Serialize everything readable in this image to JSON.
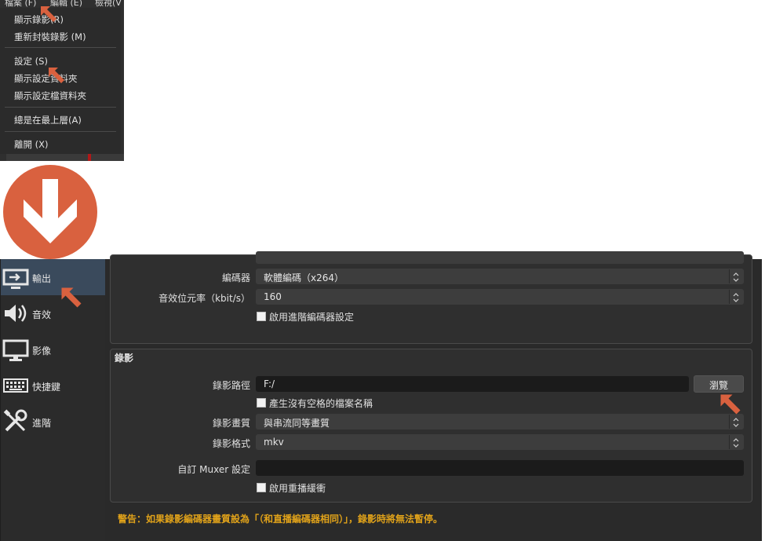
{
  "menubar": {
    "items": [
      "檔案 (F)",
      "編輯 (E)",
      "檢視(V"
    ]
  },
  "file_menu": {
    "items": [
      {
        "label": "顯示錄影(R)"
      },
      {
        "label": "重新封裝錄影 (M)"
      },
      {
        "label": "設定 (S)"
      },
      {
        "label": "顯示設定資料夾"
      },
      {
        "label": "顯示設定檔資料夾"
      },
      {
        "label": "總是在最上層(A)"
      },
      {
        "label": "離開 (X)"
      }
    ]
  },
  "colors": {
    "arrow": "#d9613f",
    "warning": "#e0a21a",
    "active_sidebar": "#3a4a5c"
  },
  "sidebar": {
    "items": [
      {
        "label": "輸出",
        "icon": "monitor-output-icon",
        "active": true
      },
      {
        "label": "音效",
        "icon": "speaker-icon"
      },
      {
        "label": "影像",
        "icon": "display-icon"
      },
      {
        "label": "快捷鍵",
        "icon": "keyboard-icon"
      },
      {
        "label": "進階",
        "icon": "tools-icon"
      }
    ]
  },
  "streaming": {
    "encoder_label": "編碼器",
    "encoder_value": "軟體編碼（x264）",
    "audio_bitrate_label": "音效位元率（kbit/s）",
    "audio_bitrate_value": "160",
    "advanced_encoder_label": "啟用進階編碼器設定"
  },
  "recording": {
    "section_title": "錄影",
    "path_label": "錄影路徑",
    "path_value": "F:/",
    "browse_label": "瀏覽",
    "no_space_label": "產生沒有空格的檔案名稱",
    "quality_label": "錄影畫質",
    "quality_value": "與串流同等畫質",
    "format_label": "錄影格式",
    "format_value": "mkv",
    "muxer_label": "自訂 Muxer 設定",
    "muxer_value": "",
    "replay_label": "啟用重播緩衝"
  },
  "warning_text": "警告：如果錄影編碼器畫質設為「（和直播編碼器相同）」，錄影時將無法暫停。"
}
